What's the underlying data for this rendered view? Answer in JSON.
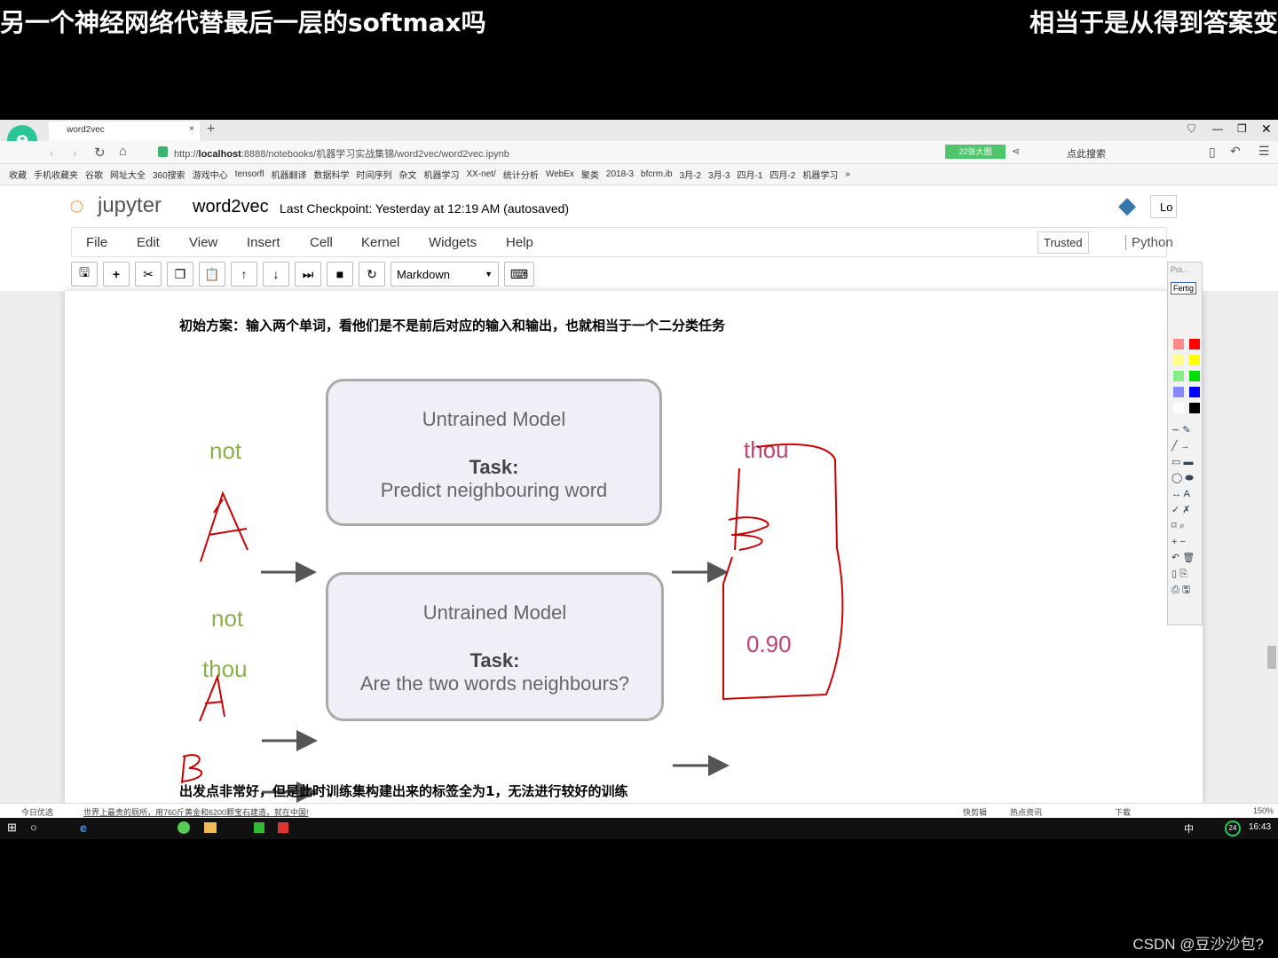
{
  "subtitles": {
    "left": "另一个神经网络代替最后一层的softmax吗",
    "right": "相当于是从得到答案变"
  },
  "browser": {
    "tab_title": "word2vec",
    "url_prefix": "http://",
    "url_host": "localhost",
    "url_rest": ":8888/notebooks/机器学习实战集锦/word2vec/word2vec.ipynb",
    "promo": "22张大图",
    "search": "点此搜索",
    "pen_label": "Poi...",
    "pen_done": "Fertig",
    "bookmarks": [
      "收藏",
      "手机收藏夹",
      "谷歌",
      "网址大全",
      "360搜索",
      "游戏中心",
      "tensorfl",
      "机器翻译",
      "数据科学",
      "时间序列",
      "杂文",
      "机器学习",
      "XX-net/",
      "统计分析",
      "WebEx",
      "聚类",
      "2018-3",
      "bfcrm.ib",
      "3月-2",
      "3月-3",
      "四月-1",
      "四月-2",
      "机器学习",
      "»"
    ]
  },
  "jupyter": {
    "logo": "jupyter",
    "notebook": "word2vec",
    "checkpoint": "Last Checkpoint: Yesterday at 12:19 AM (autosaved)",
    "logout": "Lo",
    "menu": [
      "File",
      "Edit",
      "View",
      "Insert",
      "Cell",
      "Kernel",
      "Widgets",
      "Help"
    ],
    "trusted": "Trusted",
    "kernel": "Python",
    "cell_type": "Markdown"
  },
  "cell": {
    "heading1": "初始方案：输入两个单词，看他们是不是前后对应的输入和输出，也就相当于一个二分类任务",
    "diagram1": {
      "input": "not",
      "model": "Untrained Model",
      "task_label": "Task:",
      "task": "Predict neighbouring word",
      "output": "thou"
    },
    "diagram2": {
      "input1": "not",
      "input2": "thou",
      "model": "Untrained Model",
      "task_label": "Task:",
      "task": "Are the two words neighbours?",
      "output": "0.90"
    },
    "heading2": "出发点非常好，但是此时训练集构建出来的标签全为1，无法进行较好的训练"
  },
  "statusbar": {
    "left1": "今日优选",
    "news": "世界上最贵的厕所，用760斤黄金和6200颗宝石建造，就在中国!",
    "items": [
      "快剪辑",
      "热点资讯",
      "下载"
    ],
    "zoom": "150%"
  },
  "taskbar": {
    "ime": "中",
    "badge": "24",
    "time": "16:43"
  },
  "watermark": "CSDN @豆沙沙包?",
  "colors": {
    "annotation": "#cc0000",
    "input_word": "#8ab04a",
    "output_word": "#c0446b"
  }
}
